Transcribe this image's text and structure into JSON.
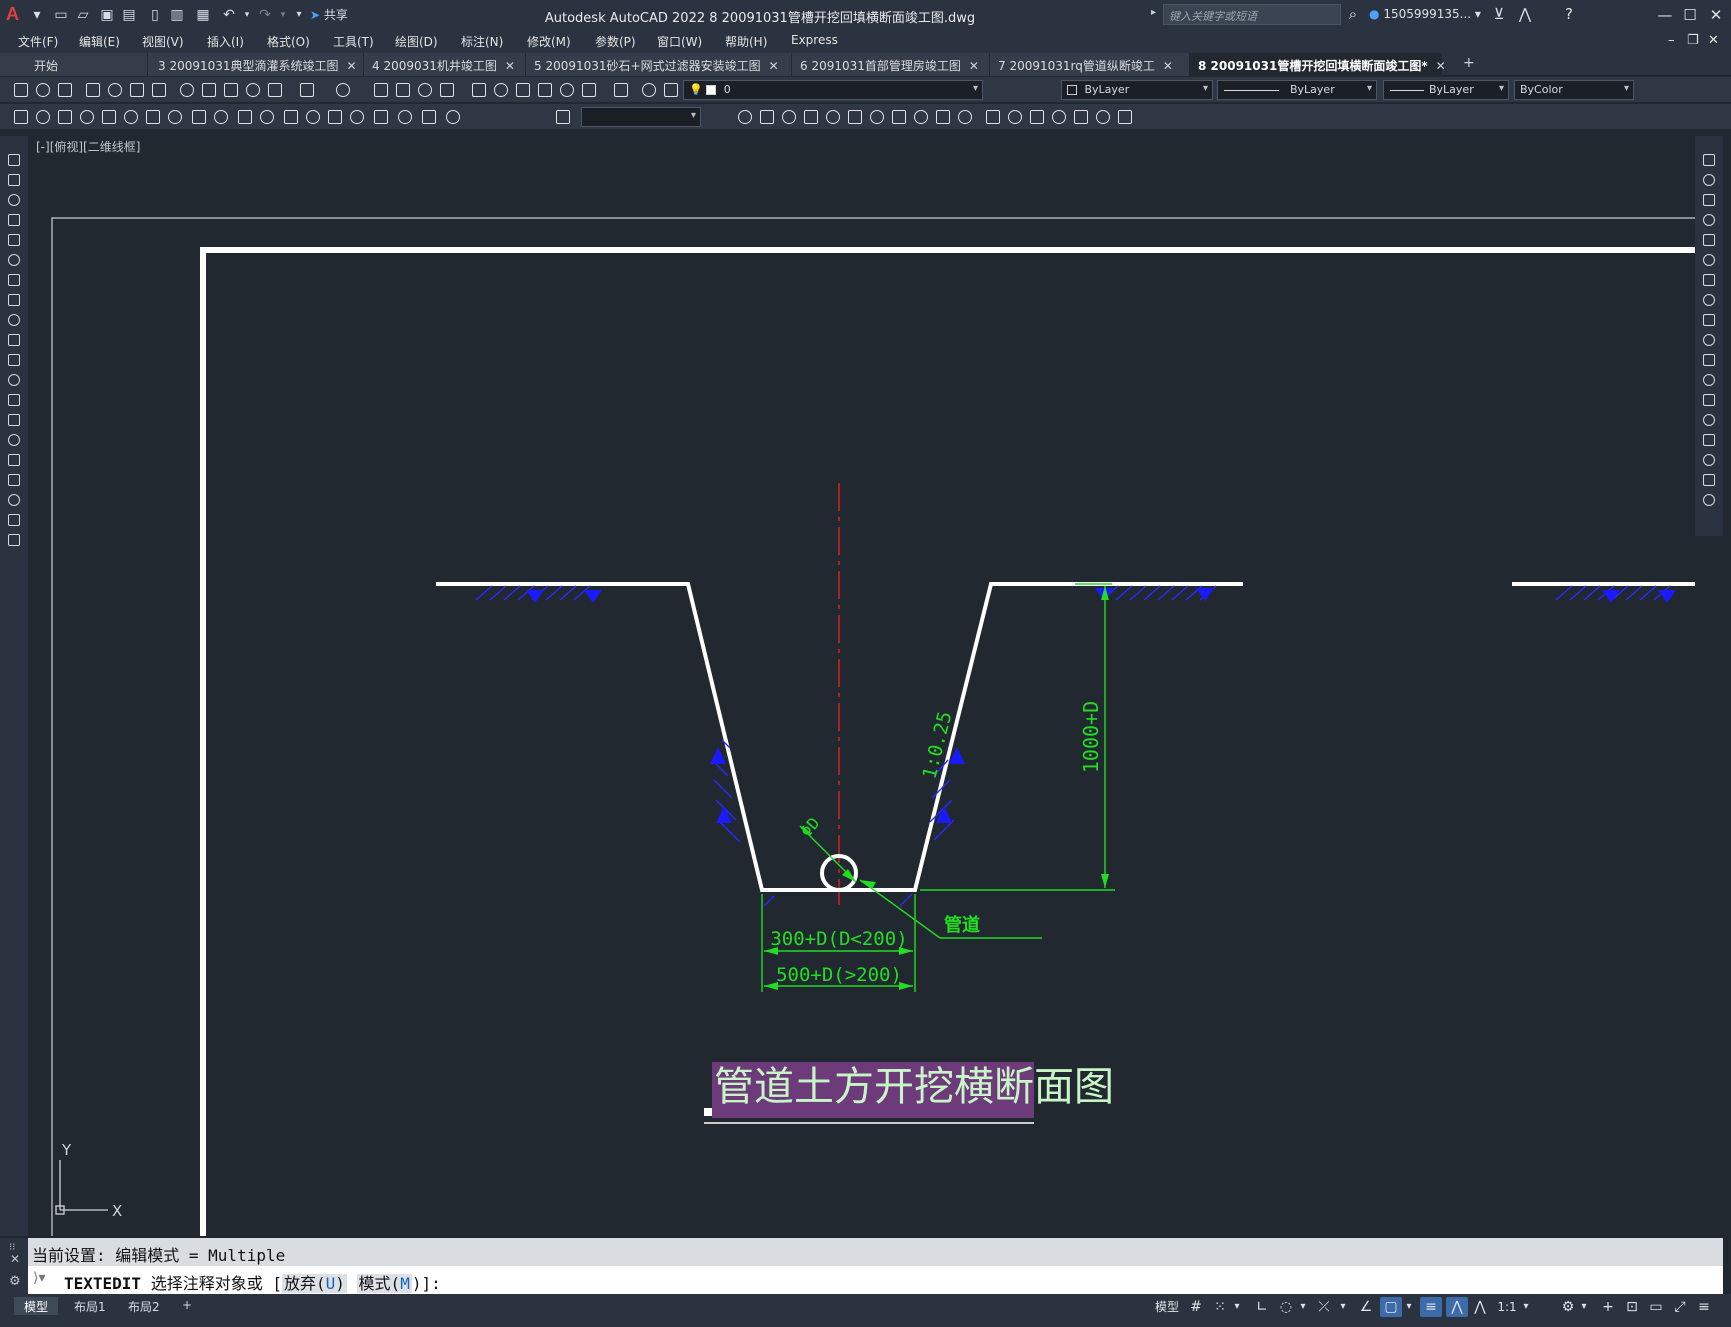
{
  "app": {
    "window_title": "Autodesk AutoCAD 2022    8  20091031管槽开挖回填横断面竣工图.dwg",
    "share_label": "共享",
    "search_placeholder": "键入关键字或短语",
    "user_name": "1505999135...",
    "logo_letter": "A"
  },
  "menu": [
    "文件(F)",
    "编辑(E)",
    "视图(V)",
    "插入(I)",
    "格式(O)",
    "工具(T)",
    "绘图(D)",
    "标注(N)",
    "修改(M)",
    "参数(P)",
    "窗口(W)",
    "帮助(H)",
    "Express"
  ],
  "tabs": [
    {
      "label": "开始"
    },
    {
      "label": "3  20091031典型滴灌系统竣工图"
    },
    {
      "label": "4  2009031机井竣工图"
    },
    {
      "label": "5  20091031砂石+网式过滤器安装竣工图"
    },
    {
      "label": "6  2091031首部管理房竣工图"
    },
    {
      "label": "7  20091031rq管道纵断竣工"
    },
    {
      "label": "8  20091031管槽开挖回填横断面竣工图*"
    }
  ],
  "tab_close_glyph": "✕",
  "add_tab_glyph": "+",
  "properties": {
    "layer": "0",
    "color": "ByLayer",
    "linetype": "ByLayer",
    "lineweight": "ByLayer",
    "plotstyle": "ByColor"
  },
  "viewport_label": "[-][俯视][二维线框]",
  "drawing": {
    "dim_width_small": "300+D(D<200)",
    "dim_width_large": "500+D(>200)",
    "dim_depth": "1000+D",
    "slope": "1:0.25",
    "pipe_diameter": "ΦD",
    "pipe_label": "管道",
    "title": "管道土方开挖横断面图",
    "ucs_x": "X",
    "ucs_y": "Y"
  },
  "command": {
    "history": "当前设置: 编辑模式 = Multiple",
    "name": "TEXTEDIT",
    "prompt": "选择注释对象或 [",
    "opt1_pre": "放弃(",
    "opt1_key": "U",
    "opt_close": ")",
    "opt2_pre": "模式(",
    "opt2_key": "M",
    "suffix": ")]:"
  },
  "status": {
    "layouts": [
      "模型",
      "布局1",
      "布局2"
    ],
    "add_layout": "+",
    "model_label": "模型",
    "scale": "1:1"
  },
  "colors": {
    "canvas": "#212830",
    "green": "#22dd22",
    "blue": "#1a1aff",
    "red": "#ff2020",
    "title_bg": "#6d3a7a"
  }
}
